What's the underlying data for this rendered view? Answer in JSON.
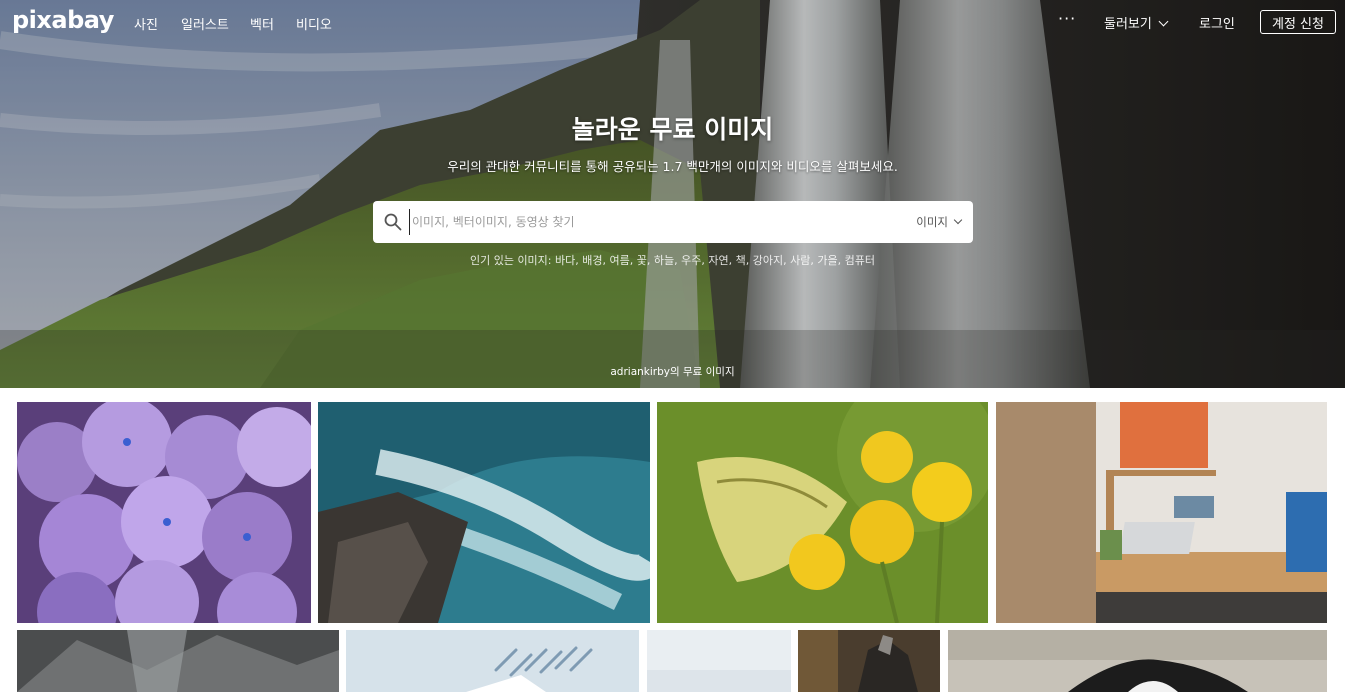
{
  "nav": {
    "logo": "pixabay",
    "links": [
      "사진",
      "일러스트",
      "벡터",
      "비디오"
    ],
    "more": "···",
    "explore": "둘러보기",
    "login": "로그인",
    "signup": "계정 신청"
  },
  "hero": {
    "title": "놀라운 무료 이미지",
    "subtitle": "우리의 관대한 커뮤니티를 통해 공유되는 1.7 백만개의 이미지와 비디오를 살펴보세요.",
    "search": {
      "placeholder": "이미지, 벡터이미지, 동영상 찾기",
      "type": "이미지"
    },
    "popular_label": "인기 있는 이미지:",
    "popular_tags": [
      "바다",
      "배경",
      "여름",
      "꽃",
      "하늘",
      "우주",
      "자연",
      "책",
      "강아지",
      "사람",
      "가을",
      "컴퓨터"
    ],
    "credit": "adriankirby의 무료 이미지"
  },
  "gallery": [
    {
      "subject": "purple-hydrangea"
    },
    {
      "subject": "ocean-waves-rocks"
    },
    {
      "subject": "butterfly-yellow-flowers"
    },
    {
      "subject": "office-desk"
    },
    {
      "subject": "rocky-mountain"
    },
    {
      "subject": "light-blue-graphic"
    },
    {
      "subject": "pale-sky"
    },
    {
      "subject": "dark-figure"
    },
    {
      "subject": "dog"
    }
  ],
  "colors": {
    "accent": "#ffffff",
    "text_dark": "#333333",
    "placeholder": "#9a9a9a"
  }
}
